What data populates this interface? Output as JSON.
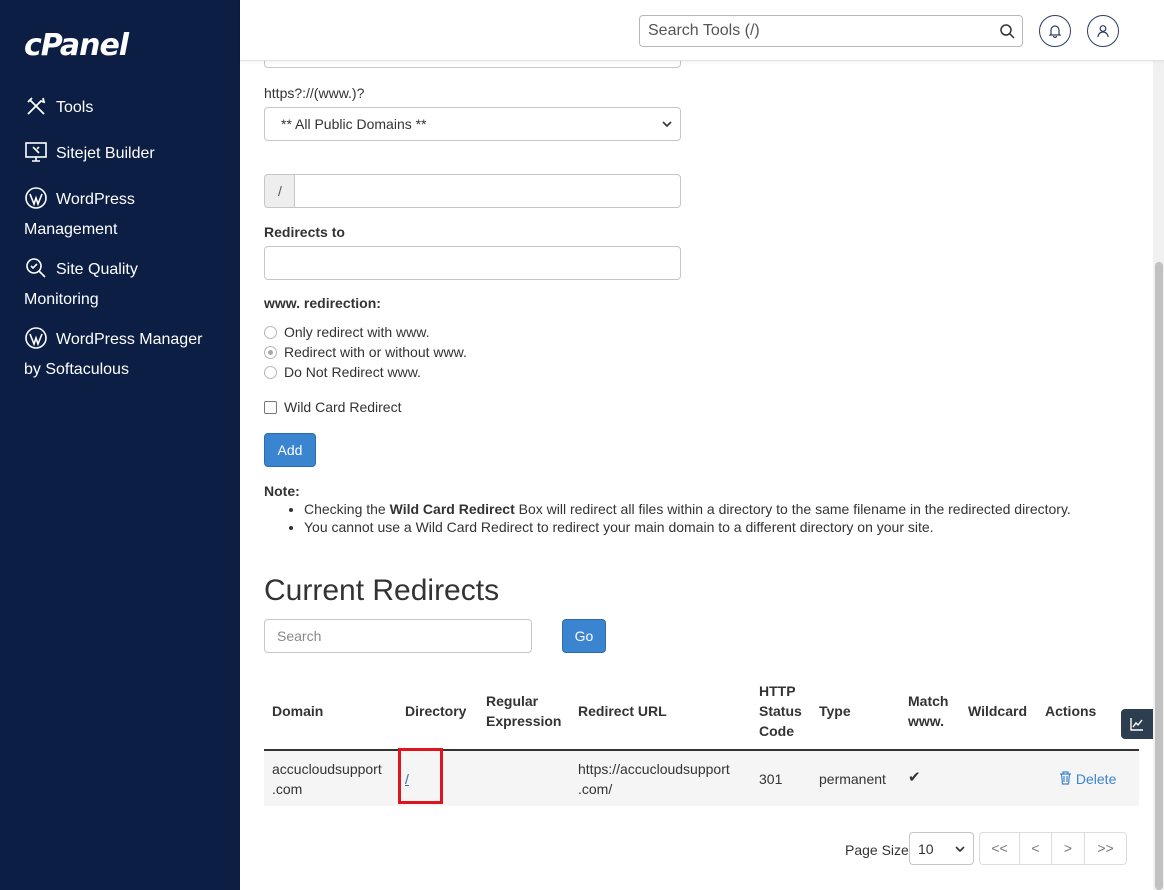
{
  "sidebar": {
    "logo": "cPanel",
    "items": [
      {
        "label": "Tools",
        "icon": "tools-icon"
      },
      {
        "label": "Sitejet Builder",
        "icon": "monitor-icon"
      },
      {
        "label": "WordPress",
        "label2": "Management",
        "icon": "wordpress-icon"
      },
      {
        "label": "Site Quality",
        "label2": "Monitoring",
        "icon": "magnifier-icon"
      },
      {
        "label": "WordPress Manager",
        "label2": "by Softaculous",
        "icon": "wordpress-icon"
      }
    ]
  },
  "header": {
    "search_placeholder": "Search Tools (/)"
  },
  "form": {
    "protocol_label": "https?://(www.)?",
    "domain_select": "** All Public Domains **",
    "path_prefix": "/",
    "redirects_to_label": "Redirects to",
    "www_label": "www. redirection:",
    "www_options": [
      {
        "label": "Only redirect with www.",
        "checked": false
      },
      {
        "label": "Redirect with or without www.",
        "checked": true
      },
      {
        "label": "Do Not Redirect www.",
        "checked": false
      }
    ],
    "wildcard_label": "Wild Card Redirect",
    "add_button": "Add"
  },
  "note": {
    "title": "Note:",
    "items": [
      {
        "pre": "Checking the ",
        "bold": "Wild Card Redirect",
        "post": " Box will redirect all files within a directory to the same filename in the redirected directory."
      },
      {
        "text": "You cannot use a Wild Card Redirect to redirect your main domain to a different directory on your site."
      }
    ]
  },
  "current": {
    "title": "Current Redirects",
    "search_placeholder": "Search",
    "go_button": "Go",
    "columns": {
      "domain": "Domain",
      "directory": "Directory",
      "regex_1": "Regular",
      "regex_2": "Expression",
      "redirect_url": "Redirect URL",
      "status_1": "HTTP",
      "status_2": "Status",
      "status_3": "Code",
      "type": "Type",
      "match_1": "Match",
      "match_2": "www.",
      "wildcard": "Wildcard",
      "actions": "Actions"
    },
    "rows": [
      {
        "domain_1": "accucloudsupport",
        "domain_2": ".com",
        "directory": "/",
        "regex": "",
        "redirect_1": "https://accucloudsupport",
        "redirect_2": ".com/",
        "status": "301",
        "type": "permanent",
        "match_www": "✔",
        "wildcard": "",
        "action": "Delete"
      }
    ],
    "page_size_label": "Page Size",
    "page_size": "10",
    "pager": [
      "<<",
      "<",
      ">",
      ">>"
    ]
  },
  "colors": {
    "sidebar": "#0c1e44",
    "primary": "#3b85d0",
    "highlight": "#e0141e"
  }
}
